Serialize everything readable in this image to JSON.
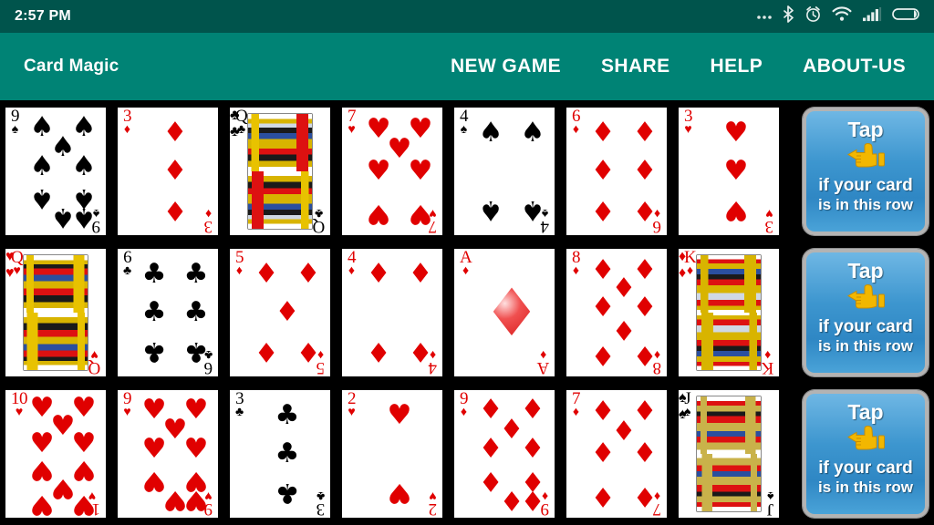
{
  "status_bar": {
    "clock": "2:57 PM",
    "icons": [
      "more-icon",
      "bluetooth-icon",
      "alarm-icon",
      "wifi-icon",
      "signal-icon",
      "battery-icon"
    ],
    "background": "#00544c"
  },
  "app_bar": {
    "title": "Card Magic",
    "background": "#008375",
    "menu": [
      {
        "label": "NEW GAME",
        "name": "menu-new-game"
      },
      {
        "label": "SHARE",
        "name": "menu-share"
      },
      {
        "label": "HELP",
        "name": "menu-help"
      },
      {
        "label": "ABOUT-US",
        "name": "menu-about-us"
      }
    ]
  },
  "table": {
    "background": "#000000",
    "card_face": "#ffffff",
    "red": "#e00000",
    "black": "#000000",
    "rows": [
      {
        "index": 0,
        "cards": [
          {
            "rank": "9",
            "suit": "spades",
            "symbol": "♠",
            "color": "black",
            "layout": "pips"
          },
          {
            "rank": "3",
            "suit": "diamonds",
            "symbol": "♦",
            "color": "red",
            "layout": "pips"
          },
          {
            "rank": "Q",
            "suit": "clubs",
            "symbol": "♣",
            "color": "black",
            "layout": "face"
          },
          {
            "rank": "7",
            "suit": "hearts",
            "symbol": "♥",
            "color": "red",
            "layout": "pips"
          },
          {
            "rank": "4",
            "suit": "spades",
            "symbol": "♠",
            "color": "black",
            "layout": "pips"
          },
          {
            "rank": "6",
            "suit": "diamonds",
            "symbol": "♦",
            "color": "red",
            "layout": "pips"
          },
          {
            "rank": "3",
            "suit": "hearts",
            "symbol": "♥",
            "color": "red",
            "layout": "pips"
          }
        ]
      },
      {
        "index": 1,
        "cards": [
          {
            "rank": "Q",
            "suit": "hearts",
            "symbol": "♥",
            "color": "red",
            "layout": "face"
          },
          {
            "rank": "6",
            "suit": "clubs",
            "symbol": "♣",
            "color": "black",
            "layout": "pips"
          },
          {
            "rank": "5",
            "suit": "diamonds",
            "symbol": "♦",
            "color": "red",
            "layout": "pips"
          },
          {
            "rank": "4",
            "suit": "diamonds",
            "symbol": "♦",
            "color": "red",
            "layout": "pips"
          },
          {
            "rank": "A",
            "suit": "diamonds",
            "symbol": "♦",
            "color": "red",
            "layout": "ace"
          },
          {
            "rank": "8",
            "suit": "diamonds",
            "symbol": "♦",
            "color": "red",
            "layout": "pips"
          },
          {
            "rank": "K",
            "suit": "diamonds",
            "symbol": "♦",
            "color": "red",
            "layout": "face"
          }
        ]
      },
      {
        "index": 2,
        "cards": [
          {
            "rank": "10",
            "suit": "hearts",
            "symbol": "♥",
            "color": "red",
            "layout": "pips"
          },
          {
            "rank": "9",
            "suit": "hearts",
            "symbol": "♥",
            "color": "red",
            "layout": "pips"
          },
          {
            "rank": "3",
            "suit": "clubs",
            "symbol": "♣",
            "color": "black",
            "layout": "pips"
          },
          {
            "rank": "2",
            "suit": "hearts",
            "symbol": "♥",
            "color": "red",
            "layout": "pips"
          },
          {
            "rank": "9",
            "suit": "diamonds",
            "symbol": "♦",
            "color": "red",
            "layout": "pips"
          },
          {
            "rank": "7",
            "suit": "diamonds",
            "symbol": "♦",
            "color": "red",
            "layout": "pips"
          },
          {
            "rank": "J",
            "suit": "spades",
            "symbol": "♠",
            "color": "black",
            "layout": "face"
          }
        ]
      }
    ]
  },
  "tap_buttons": {
    "count": 3,
    "line1": "Tap",
    "hand_icon": "pointing-hand-icon",
    "hand_glyph": "☚",
    "line2": "if your card",
    "line3": "is in this row",
    "fill": "#3d96cf",
    "border": "#b3b3b3",
    "text_color": "#ffffff"
  }
}
